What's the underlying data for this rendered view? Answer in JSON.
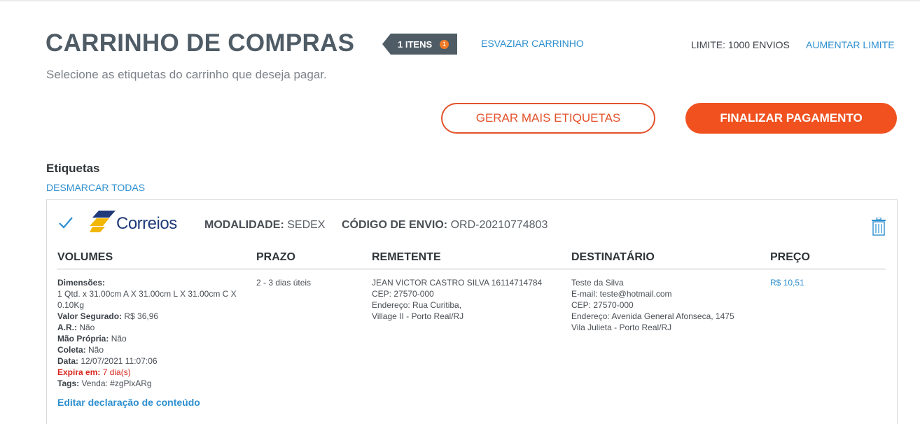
{
  "header": {
    "title": "CARRINHO DE COMPRAS",
    "items_label": "1 ITENS",
    "items_count": "1",
    "empty_cart": "ESVAZIAR CARRINHO",
    "limit_text": "LIMITE: 1000 ENVIOS",
    "increase_limit": "AUMENTAR LIMITE",
    "subtitle": "Selecione as etiquetas do carrinho que deseja pagar."
  },
  "actions": {
    "generate_more": "GERAR MAIS ETIQUETAS",
    "checkout": "FINALIZAR PAGAMENTO"
  },
  "labels_section": {
    "title": "Etiquetas",
    "unselect_all": "DESMARCAR TODAS"
  },
  "label_card": {
    "carrier": "Correios",
    "modality_label": "MODALIDADE:",
    "modality_value": "SEDEX",
    "code_label": "CÓDIGO DE ENVIO:",
    "code_value": "ORD-20210774803",
    "columns": [
      "VOLUMES",
      "PRAZO",
      "REMETENTE",
      "DESTINATÁRIO",
      "PREÇO"
    ],
    "volumes": {
      "dim_label": "Dimensões:",
      "dim_line1": "1 Qtd. x 31.00cm A X 31.00cm L X 31.00cm C X",
      "dim_line2": "0.10Kg",
      "insured_label": "Valor Segurado:",
      "insured_value": "R$ 36,96",
      "ar_label": "A.R.:",
      "ar_value": "Não",
      "own_hand_label": "Mão Própria:",
      "own_hand_value": "Não",
      "pickup_label": "Coleta:",
      "pickup_value": "Não",
      "date_label": "Data:",
      "date_value": "12/07/2021 11:07:06",
      "expires_label": "Expira em:",
      "expires_value": "7 dia(s)",
      "tags_label": "Tags:",
      "tags_value": "Venda: #zgPlxARg"
    },
    "deadline": "2 - 3 dias úteis",
    "sender": [
      "JEAN VICTOR CASTRO SILVA 16114714784",
      "CEP: 27570-000",
      "Endereço: Rua Curitiba,",
      "Village II - Porto Real/RJ"
    ],
    "recipient": [
      "Teste da Silva",
      "E-mail: teste@hotmail.com",
      "CEP: 27570-000",
      "Endereço: Avenida General Afonseca, 1475",
      "Vila Julieta - Porto Real/RJ"
    ],
    "price": "R$ 10,51",
    "edit_declaration": "Editar declaração de conteúdo"
  },
  "colors": {
    "accent": "#f0511f",
    "link": "#2d8fcf",
    "title": "#4f5c66",
    "badge": "#4f5c66",
    "warning": "#d9261c"
  },
  "icons": [
    "check-icon",
    "correios-logo",
    "trash-icon",
    "items-count-badge"
  ]
}
